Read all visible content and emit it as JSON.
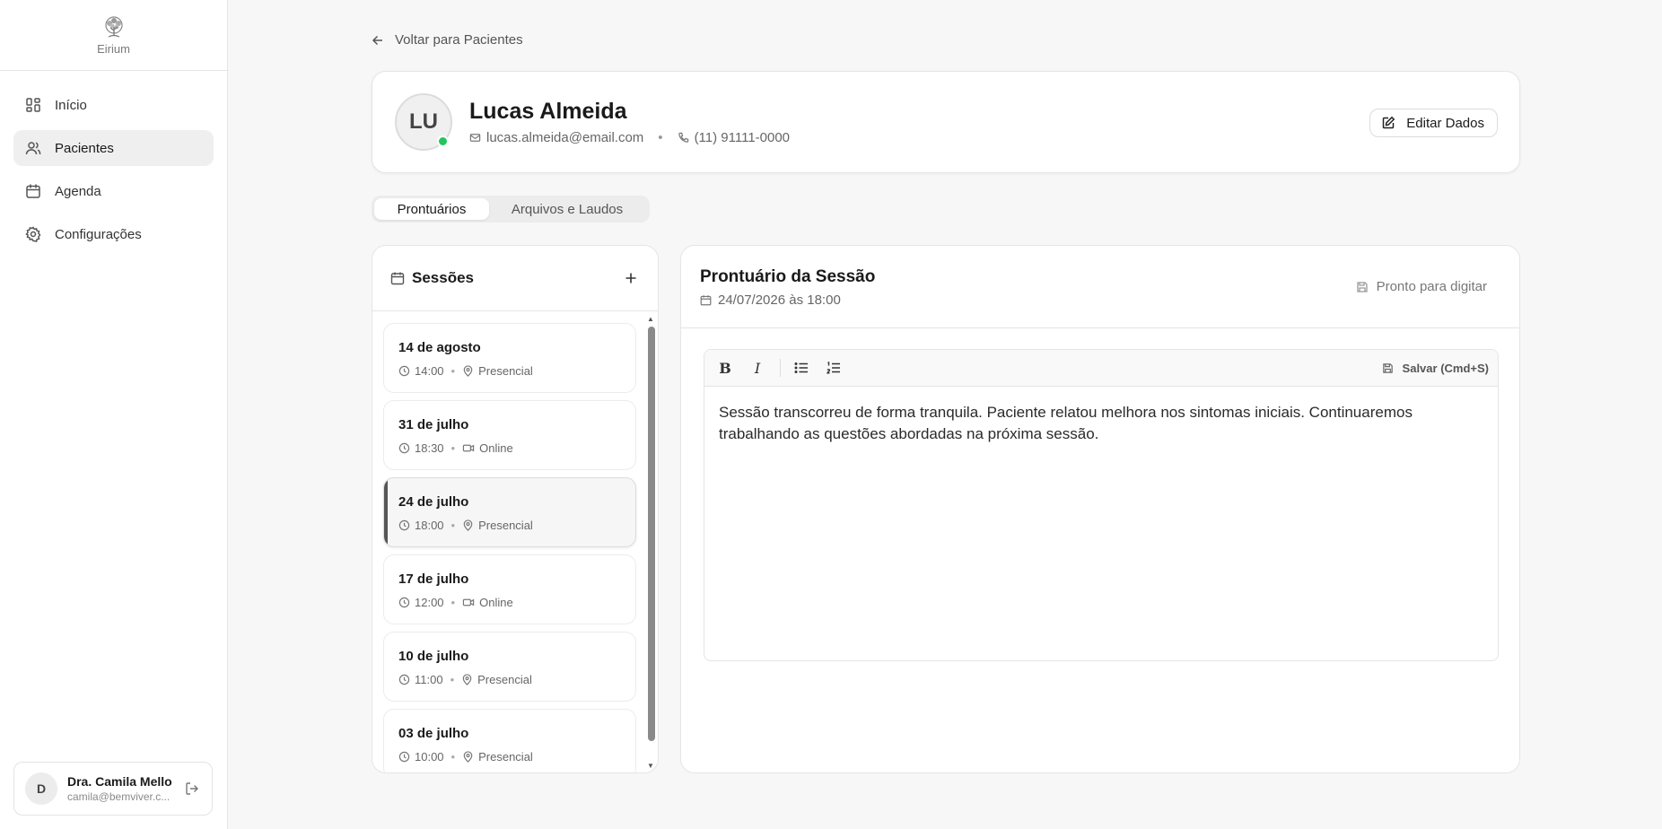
{
  "sidebar": {
    "logo_text": "Eirium",
    "items": [
      {
        "label": "Início",
        "icon": "dashboard-icon"
      },
      {
        "label": "Pacientes",
        "icon": "users-icon"
      },
      {
        "label": "Agenda",
        "icon": "calendar-icon"
      },
      {
        "label": "Configurações",
        "icon": "gear-icon"
      }
    ],
    "active_item": "Pacientes",
    "user": {
      "initial": "D",
      "name": "Dra. Camila Mello",
      "email": "camila@bemviver.c..."
    }
  },
  "back_link": "Voltar para Pacientes",
  "patient": {
    "initials": "LU",
    "name": "Lucas Almeida",
    "email": "lucas.almeida@email.com",
    "phone": "(11) 91111-0000",
    "status_color": "#22c55e",
    "edit_label": "Editar Dados"
  },
  "tabs": [
    {
      "label": "Prontuários",
      "active": true
    },
    {
      "label": "Arquivos e Laudos",
      "active": false
    }
  ],
  "sessions": {
    "title": "Sessões",
    "items": [
      {
        "date": "14 de agosto",
        "time": "14:00",
        "mode": "Presencial"
      },
      {
        "date": "31 de julho",
        "time": "18:30",
        "mode": "Online"
      },
      {
        "date": "24 de julho",
        "time": "18:00",
        "mode": "Presencial",
        "active": true
      },
      {
        "date": "17 de julho",
        "time": "12:00",
        "mode": "Online"
      },
      {
        "date": "10 de julho",
        "time": "11:00",
        "mode": "Presencial"
      },
      {
        "date": "03 de julho",
        "time": "10:00",
        "mode": "Presencial"
      }
    ]
  },
  "record": {
    "title": "Prontuário da Sessão",
    "datetime": "24/07/2026 às 18:00",
    "status": "Pronto para digitar",
    "save_label": "Salvar (Cmd+S)",
    "toolbar": {
      "bold": "B",
      "italic": "I"
    },
    "content": "Sessão transcorreu de forma tranquila. Paciente relatou melhora nos sintomas iniciais. Continuaremos trabalhando as questões abordadas na próxima sessão."
  }
}
